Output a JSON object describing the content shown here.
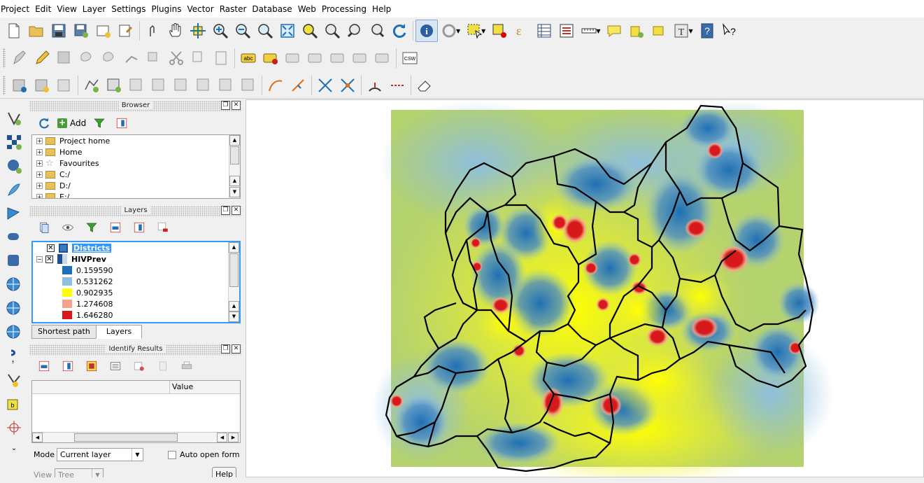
{
  "menu": [
    "Project",
    "Edit",
    "View",
    "Layer",
    "Settings",
    "Plugins",
    "Vector",
    "Raster",
    "Database",
    "Web",
    "Processing",
    "Help"
  ],
  "browser": {
    "title": "Browser",
    "add_label": "Add",
    "items": [
      "Project home",
      "Home",
      "Favourites",
      "C:/",
      "D:/",
      "E:/"
    ]
  },
  "layers": {
    "title": "Layers",
    "districts": "Districts",
    "hivprev": "HIVPrev",
    "legend": [
      {
        "label": "0.159590",
        "color": "#1f6fb4"
      },
      {
        "label": "0.531262",
        "color": "#8fbfdc"
      },
      {
        "label": "0.902935",
        "color": "#ffff00"
      },
      {
        "label": "1.274608",
        "color": "#f7a08a"
      },
      {
        "label": "1.646280",
        "color": "#d7191c"
      }
    ],
    "tabs": [
      "Shortest path",
      "Layers"
    ]
  },
  "identify": {
    "title": "Identify Results",
    "col_value": "Value",
    "mode_label": "Mode",
    "mode_value": "Current layer",
    "auto_open": "Auto open form",
    "view_label": "View",
    "view_value": "Tree",
    "help": "Help"
  },
  "colors": {
    "accent": "#3399ff",
    "map_background": "#b4d26e"
  }
}
